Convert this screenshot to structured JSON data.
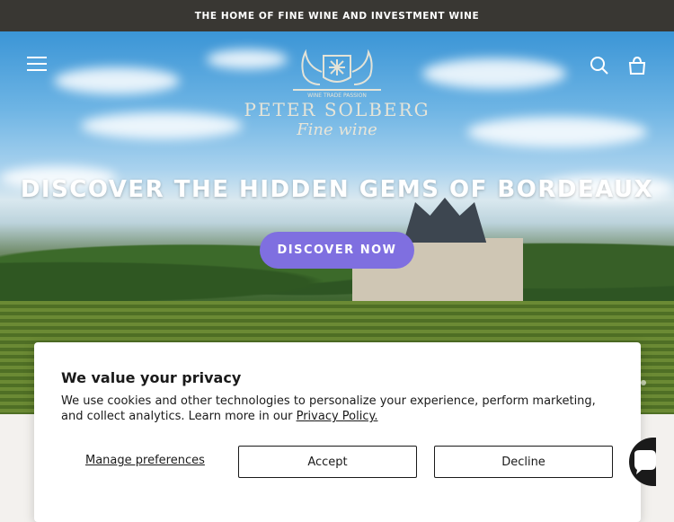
{
  "announcement": {
    "text": "THE HOME OF FINE WINE AND INVESTMENT WINE"
  },
  "header": {
    "menu_icon": "hamburger-menu-icon",
    "search_icon": "search-icon",
    "cart_icon": "shopping-bag-icon",
    "logo": {
      "crest_text": "WINE  TRADE  PASSION",
      "brand": "PETER SOLBERG",
      "sub": "Fine wine"
    }
  },
  "hero": {
    "headline": "DISCOVER THE HIDDEN GEMS OF BORDEAUX",
    "cta_label": "DISCOVER NOW"
  },
  "cookie_banner": {
    "title": "We value your privacy",
    "body": "We use cookies and other technologies to personalize your experience, perform marketing, and collect analytics. Learn more in our ",
    "link": "Privacy Policy.",
    "manage_label": "Manage preferences",
    "accept_label": "Accept",
    "decline_label": "Decline"
  },
  "chat_widget": {
    "icon": "chat-icon"
  },
  "colors": {
    "announce_bg": "#393733",
    "cta_bg": "#7f6fe0",
    "page_bg": "#f3f1ee"
  }
}
